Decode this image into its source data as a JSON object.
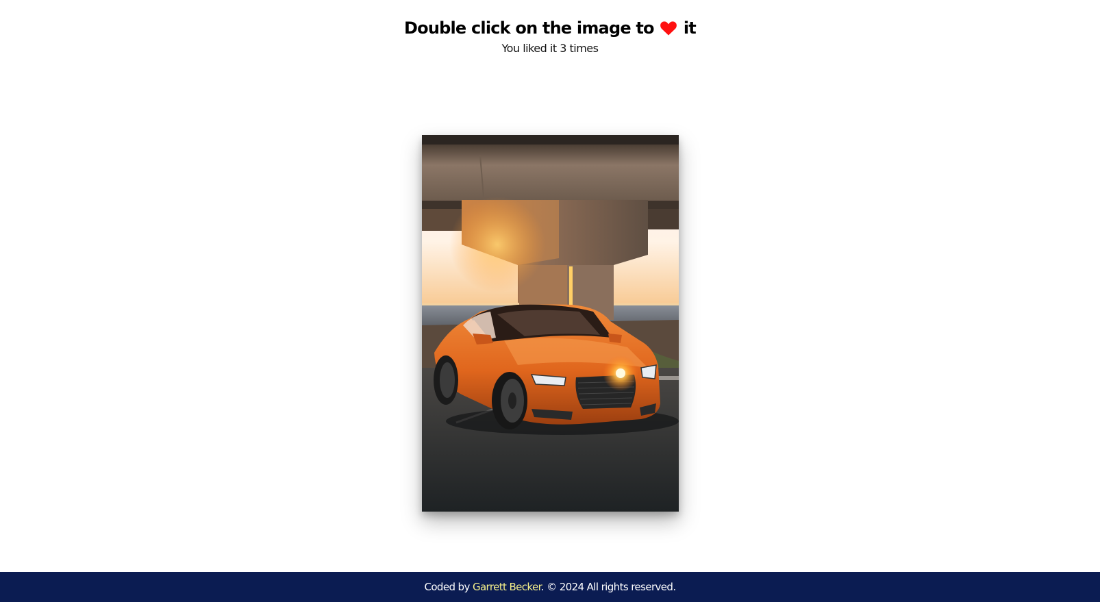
{
  "header": {
    "title_before": "Double click on the image to",
    "heart_icon": "heart-icon",
    "heart_color": "#ff1010",
    "title_after": "it",
    "likes_prefix": "You liked it",
    "likes_count": "3",
    "likes_suffix": "times"
  },
  "photo": {
    "alt": "Orange car parked under a concrete bridge at sunset"
  },
  "footer": {
    "prefix": "Coded by",
    "author": "Garrett Becker",
    "suffix": ". © 2024 All rights reserved.",
    "background": "#0b1c52",
    "link_color": "#f6f08a"
  }
}
